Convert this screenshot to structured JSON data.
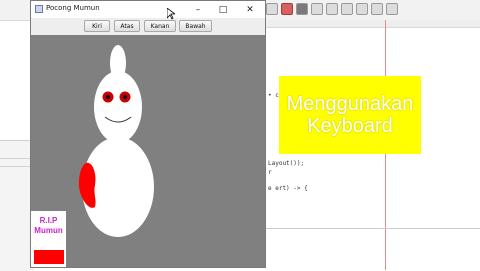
{
  "window": {
    "title": "Pocong Mumun",
    "controls": {
      "minimize": "–",
      "maximize": "□",
      "close": "✕"
    }
  },
  "buttons": [
    "Kiri",
    "Atas",
    "Kanan",
    "Bawah"
  ],
  "sign": {
    "line1": "R.I.P",
    "line2": "Mumun"
  },
  "overlay": {
    "line1": "Menggunakan",
    "line2": "Keyboard"
  },
  "code_lines": [
    {
      "text": "• co..."
    },
    {
      "text": "Layout());"
    },
    {
      "text": "r"
    },
    {
      "text": "e ert) -> {"
    }
  ],
  "colors": {
    "canvas": "#808080",
    "ghost": "#ffffff",
    "eyes": "#ff0000",
    "blood": "#ff0000",
    "sign_text": "#cc22cc",
    "overlay": "#ffff00"
  }
}
